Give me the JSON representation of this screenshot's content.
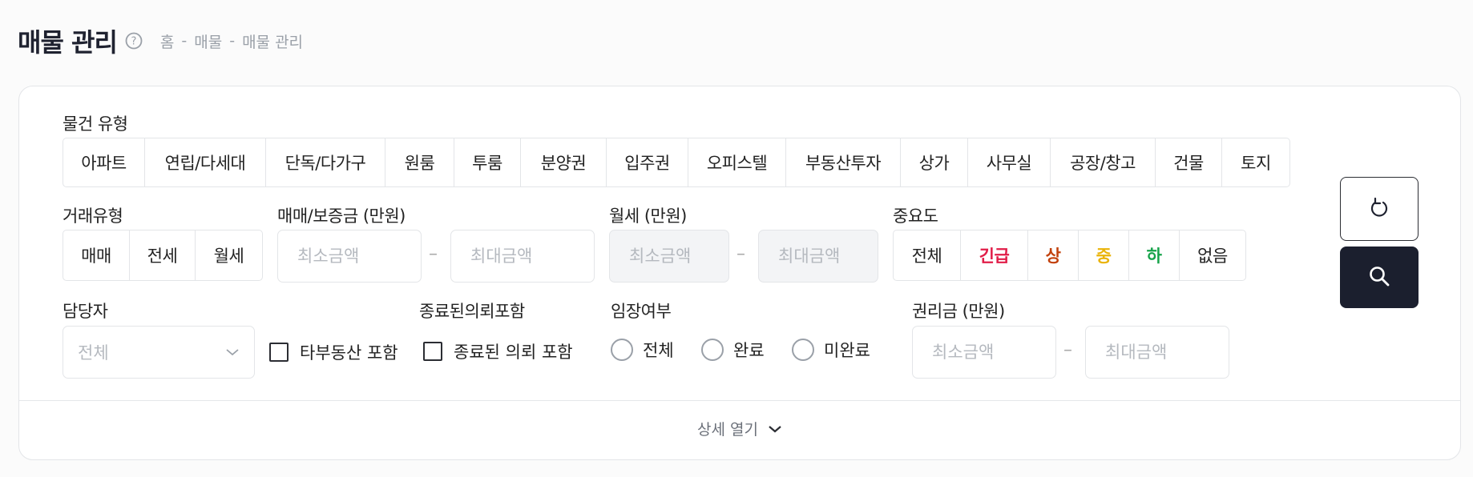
{
  "page": {
    "title": "매물 관리",
    "breadcrumb": [
      "홈",
      "매물",
      "매물 관리"
    ],
    "breadcrumb_sep": "-"
  },
  "filters": {
    "property_type": {
      "label": "물건 유형",
      "options": [
        "아파트",
        "연립/다세대",
        "단독/다가구",
        "원룸",
        "투룸",
        "분양권",
        "입주권",
        "오피스텔",
        "부동산투자",
        "상가",
        "사무실",
        "공장/창고",
        "건물",
        "토지"
      ]
    },
    "deal_type": {
      "label": "거래유형",
      "options": [
        "매매",
        "전세",
        "월세"
      ]
    },
    "deposit": {
      "label": "매매/보증금 (만원)",
      "min_placeholder": "최소금액",
      "max_placeholder": "최대금액"
    },
    "monthly_rent": {
      "label": "월세 (만원)",
      "min_placeholder": "최소금액",
      "max_placeholder": "최대금액"
    },
    "importance": {
      "label": "중요도",
      "options": [
        {
          "label": "전체",
          "color": "#222222"
        },
        {
          "label": "긴급",
          "color": "#e11d48"
        },
        {
          "label": "상",
          "color": "#c2410c"
        },
        {
          "label": "중",
          "color": "#eab308"
        },
        {
          "label": "하",
          "color": "#16a34a"
        },
        {
          "label": "없음",
          "color": "#222222"
        }
      ]
    },
    "manager": {
      "label": "담당자",
      "value": "전체"
    },
    "other_agency": {
      "label": "타부동산 포함"
    },
    "closed_request": {
      "label": "종료된의뢰포함",
      "checkbox_label": "종료된 의뢰 포함"
    },
    "visit": {
      "label": "임장여부",
      "options": [
        "전체",
        "완료",
        "미완료"
      ]
    },
    "premium": {
      "label": "권리금 (만원)",
      "min_placeholder": "최소금액",
      "max_placeholder": "최대금액"
    },
    "range_sep": "–"
  },
  "footer": {
    "expand_label": "상세 열기"
  },
  "actions": {
    "reset_icon": "refresh-icon",
    "search_icon": "search-icon"
  }
}
